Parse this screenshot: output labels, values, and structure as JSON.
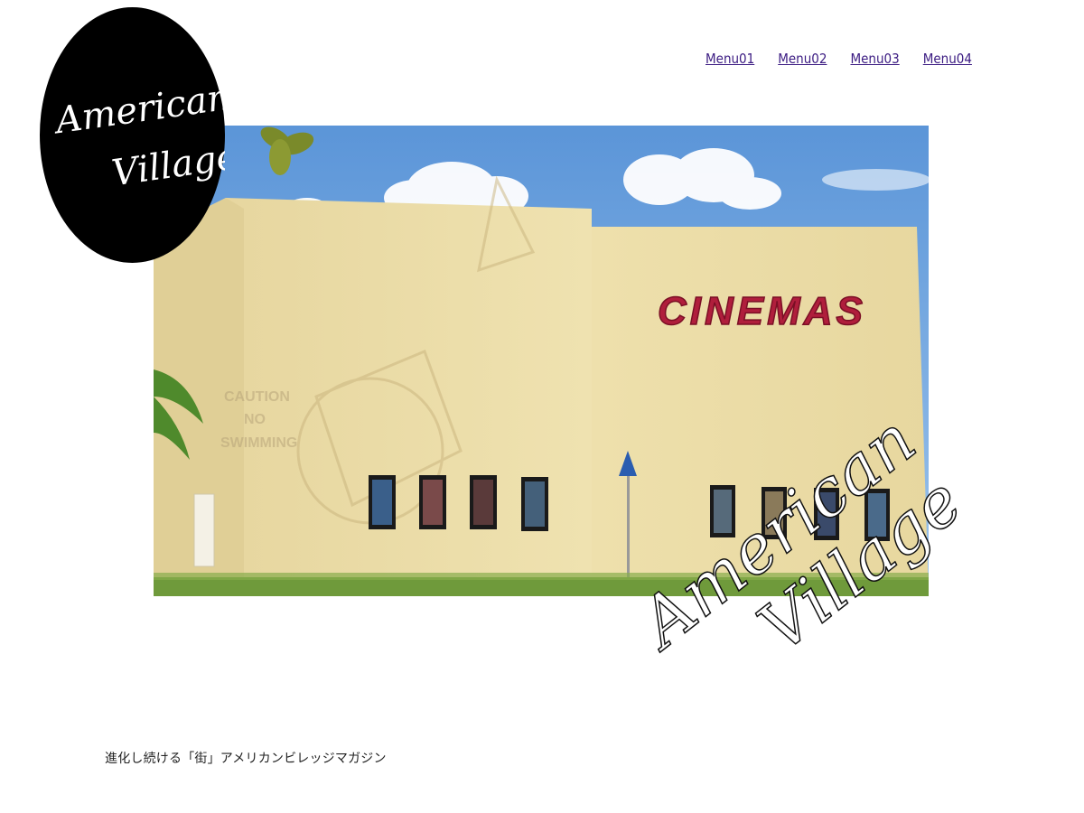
{
  "logo": {
    "line1": "American",
    "line2": "Village"
  },
  "nav": {
    "items": [
      {
        "label": "Menu01"
      },
      {
        "label": "Menu02"
      },
      {
        "label": "Menu03"
      },
      {
        "label": "Menu04"
      }
    ]
  },
  "hero": {
    "sign_text": "CINEMAS",
    "caution_lines": [
      "CAUTION",
      "NO",
      "SWIMMING"
    ],
    "overlay_line1": "American",
    "overlay_line2": "Village"
  },
  "tagline": "進化し続ける「街」アメリカンビレッジマガジン",
  "colors": {
    "nav_link": "#3b1b82",
    "sky": "#6fa3dd",
    "wall": "#ecdda7",
    "sign_red": "#b01e3c",
    "grass": "#6f9a3b"
  }
}
